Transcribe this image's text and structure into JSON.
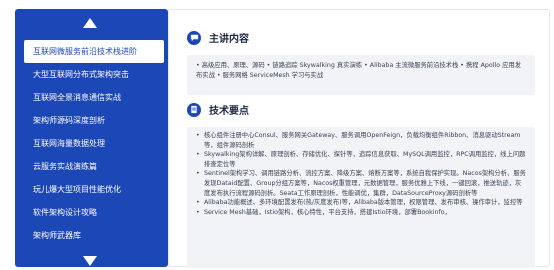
{
  "sidebar": {
    "items": [
      {
        "label": "互联网微服务前沿技术栈进阶",
        "active": true
      },
      {
        "label": "大型互联网分布式架构突击",
        "active": false
      },
      {
        "label": "互联网全景消息通信实战",
        "active": false
      },
      {
        "label": "架构师源码深度剖析",
        "active": false
      },
      {
        "label": "互联网海量数据处理",
        "active": false
      },
      {
        "label": "云服务实战演练篇",
        "active": false
      },
      {
        "label": "玩儿爆大型项目性能优化",
        "active": false
      },
      {
        "label": "软件架构设计攻略",
        "active": false
      },
      {
        "label": "架构师武器库",
        "active": false
      }
    ]
  },
  "main": {
    "section1": {
      "title": "主讲内容",
      "text": "• 高级应用、原理、源码  • 链路追踪 Skywalking 真实演练  • Alibaba 主流微服务前沿技术栈  • 携程 Apollo 应用发布实战  • 服务网格 ServiceMesh 学习与实战"
    },
    "section2": {
      "title": "技术要点",
      "items": [
        "核心组件注册中心Consul、服务网关Gateway、服务调用OpenFeign，负载均衡组件Ribbon、消息驱动Stream等，组件源码剖析",
        "Skywalking架构详解、原理剖析、存储优化、探针等，追踪信息获取、MySQL调用监控，RPC调用监控，线上问题排查定位等",
        "Sentinel架构学习、调用链路分析、流控方案、降级方案、熔断方案等，系统自我保护实现。Nacos架构分析、服务发现Dataid配置、Group分组方案等，Nacos权重管理，元数据管理，服务优雅上下线，一键回滚，推送轨迹，灰度发布执行流程源码剖析。Seata工作原理剖析，性能调优，集群，DataSourceProxy源码剖析等",
        "Alibaba功能概述、多环境配置发布(热/灰度发布)等，Alibaba版本管理，权限管理、发布审核、操作审计，监控等",
        "Service Mesh基础，Istio架构，核心特性，平台支持，搭建Istio环境，部署Bookinfo，"
      ]
    }
  }
}
